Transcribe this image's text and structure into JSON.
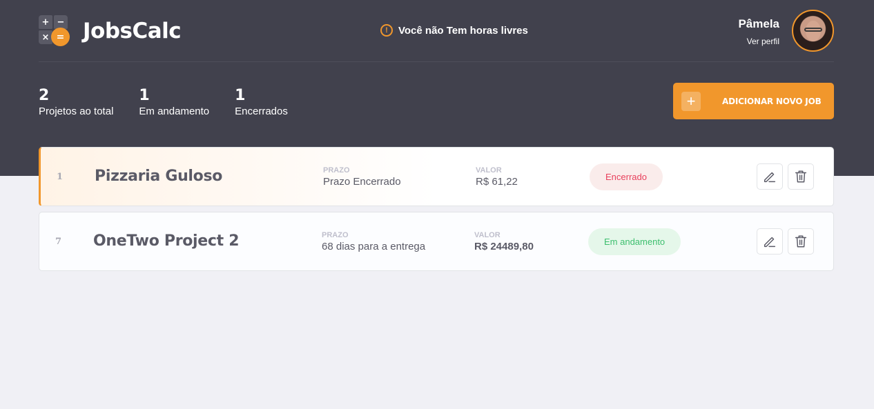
{
  "app": {
    "name": "JobsCalc",
    "logo_symbols": [
      "+",
      "−",
      "×",
      "="
    ]
  },
  "alert": {
    "text": "Você não Tem horas livres",
    "icon": "alert-circle-icon"
  },
  "profile": {
    "name": "Pâmela",
    "link": "Ver perfil"
  },
  "stats": [
    {
      "value": "2",
      "label": "Projetos ao total"
    },
    {
      "value": "1",
      "label": "Em andamento"
    },
    {
      "value": "1",
      "label": "Encerrados"
    }
  ],
  "add_button": {
    "icon": "+",
    "label": "ADICIONAR NOVO JOB"
  },
  "jobs": [
    {
      "id": "1",
      "name": "Pizzaria Guloso",
      "deadline_label": "PRAZO",
      "deadline": "Prazo Encerrado",
      "value_label": "VALOR",
      "value": "R$ 61,22",
      "status": "Encerrado"
    },
    {
      "id": "7",
      "name": "OneTwo Project 2",
      "deadline_label": "PRAZO",
      "deadline": "68 dias para a entrega",
      "value_label": "VALOR",
      "value": "R$ 24489,80",
      "status": "Em andamento"
    }
  ],
  "colors": {
    "header_bg": "#41414D",
    "accent": "#F1972C",
    "page_bg": "#F0F0F5",
    "status_closed_bg": "#FAECEB",
    "status_closed_text": "#E83F5B",
    "status_open_bg": "#E5F7EA",
    "status_open_text": "#3DBF6E"
  }
}
